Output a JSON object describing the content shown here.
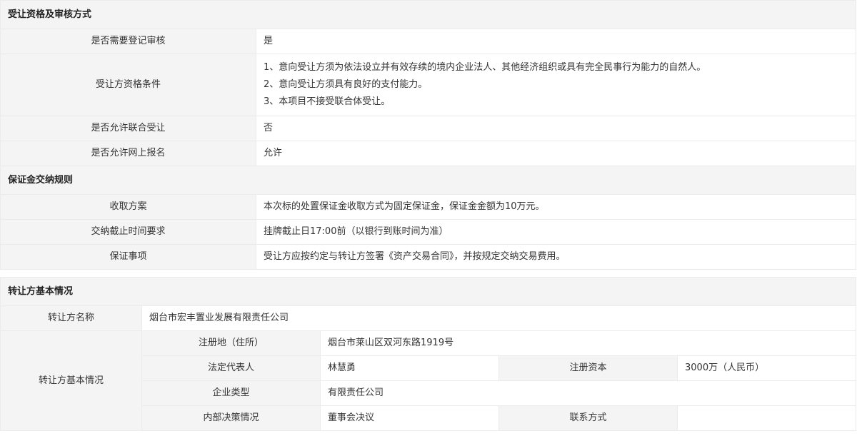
{
  "section1": {
    "title": "受让资格及审核方式",
    "rows": [
      {
        "label": "是否需要登记审核",
        "value": "是"
      },
      {
        "label": "受让方资格条件",
        "lines": [
          "1、意向受让方须为依法设立并有效存续的境内企业法人、其他经济组织或具有完全民事行为能力的自然人。",
          "2、意向受让方须具有良好的支付能力。",
          "3、本项目不接受联合体受让。"
        ]
      },
      {
        "label": "是否允许联合受让",
        "value": "否"
      },
      {
        "label": "是否允许网上报名",
        "value": "允许"
      }
    ]
  },
  "section2": {
    "title": "保证金交纳规则",
    "rows": [
      {
        "label": "收取方案",
        "value": "本次标的处置保证金收取方式为固定保证金，保证金金额为10万元。"
      },
      {
        "label": "交纳截止时间要求",
        "value": "挂牌截止日17:00前（以银行到账时间为准）"
      },
      {
        "label": "保证事项",
        "value": "受让方应按约定与转让方签署《资产交易合同》，并按规定交纳交易费用。"
      }
    ]
  },
  "section3": {
    "title": "转让方基本情况",
    "name_label": "转让方名称",
    "name_value": "烟台市宏丰置业发展有限责任公司",
    "basic_label": "转让方基本情况",
    "address_label": "注册地（住所）",
    "address_value": "烟台市莱山区双河东路1919号",
    "legal_rep_label": "法定代表人",
    "legal_rep_value": "林慧勇",
    "capital_label": "注册资本",
    "capital_value": "3000万（人民币）",
    "company_type_label": "企业类型",
    "company_type_value": "有限责任公司",
    "decision_label": "内部决策情况",
    "decision_value": "董事会决议",
    "contact_label": "联系方式",
    "contact_value": ""
  }
}
